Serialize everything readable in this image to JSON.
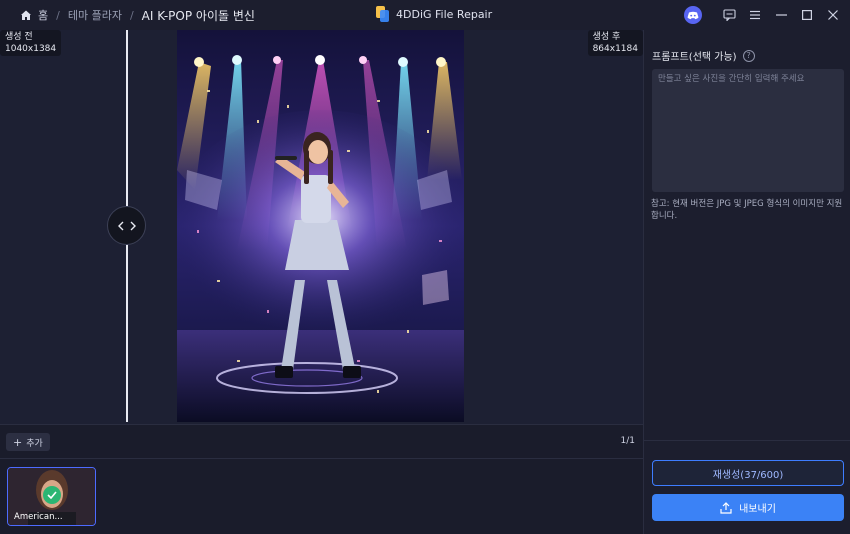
{
  "titlebar": {
    "breadcrumb": [
      "홈",
      "테마 플라자",
      "AI K-POP 아이돌 변신"
    ],
    "app_title": "4DDiG File Repair"
  },
  "workarea": {
    "before_label": "생성 전",
    "before_size": "1040x1384",
    "after_label": "생성 후",
    "after_size": "864x1184"
  },
  "bottom": {
    "add_label": "추가",
    "page_count": "1/1",
    "thumb_label": "American..."
  },
  "panel": {
    "prompt_title": "프롬프트(선택 가능)",
    "prompt_placeholder": "만들고 싶은 사진을 간단히 입력해 주세요",
    "note": "참고: 현재 버전은 JPG 및 JPEG 형식의 이미지만 지원합니다.",
    "regenerate_label": "재생성(37/600)",
    "export_label": "내보내기"
  },
  "colors": {
    "accent": "#3b82f6",
    "background": "#1a1c2b",
    "success": "#2bb673"
  }
}
